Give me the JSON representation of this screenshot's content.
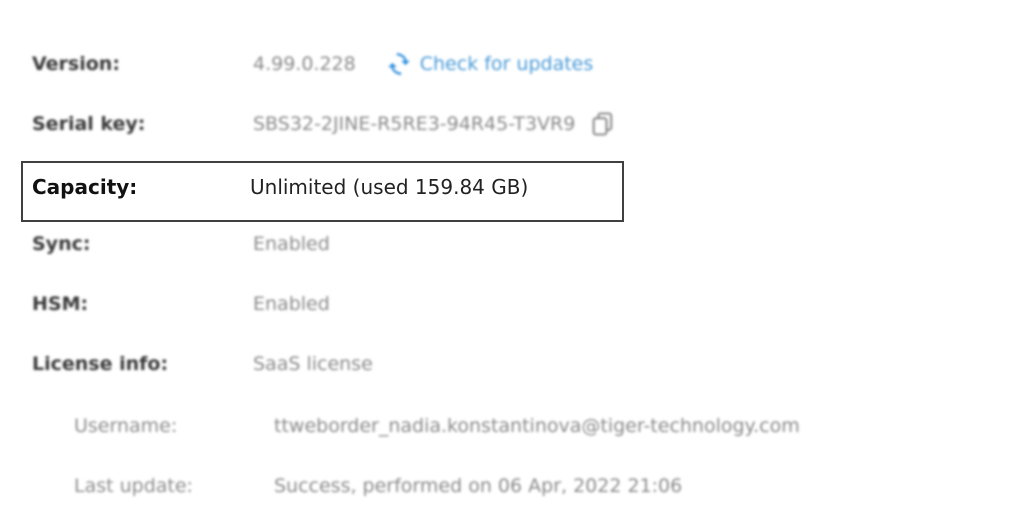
{
  "version": {
    "label": "Version:",
    "value": "4.99.0.228",
    "check_updates": "Check for updates"
  },
  "serial": {
    "label": "Serial key:",
    "value": "SBS32-2JINE-R5RE3-94R45-T3VR9"
  },
  "capacity": {
    "label": "Capacity:",
    "value": "Unlimited (used 159.84 GB)"
  },
  "sync": {
    "label": "Sync:",
    "value": "Enabled"
  },
  "hsm": {
    "label": "HSM:",
    "value": "Enabled"
  },
  "license": {
    "label": "License info:",
    "value": "SaaS license"
  },
  "username": {
    "label": "Username:",
    "value": "ttweborder_nadia.konstantinova@tiger-technology.com"
  },
  "last_update": {
    "label": "Last update:",
    "value": "Success, performed on 06 Apr, 2022 21:06"
  },
  "colors": {
    "link": "#4a9ad8",
    "highlight_border": "#404040"
  },
  "icons": [
    "refresh-icon",
    "copy-icon"
  ]
}
